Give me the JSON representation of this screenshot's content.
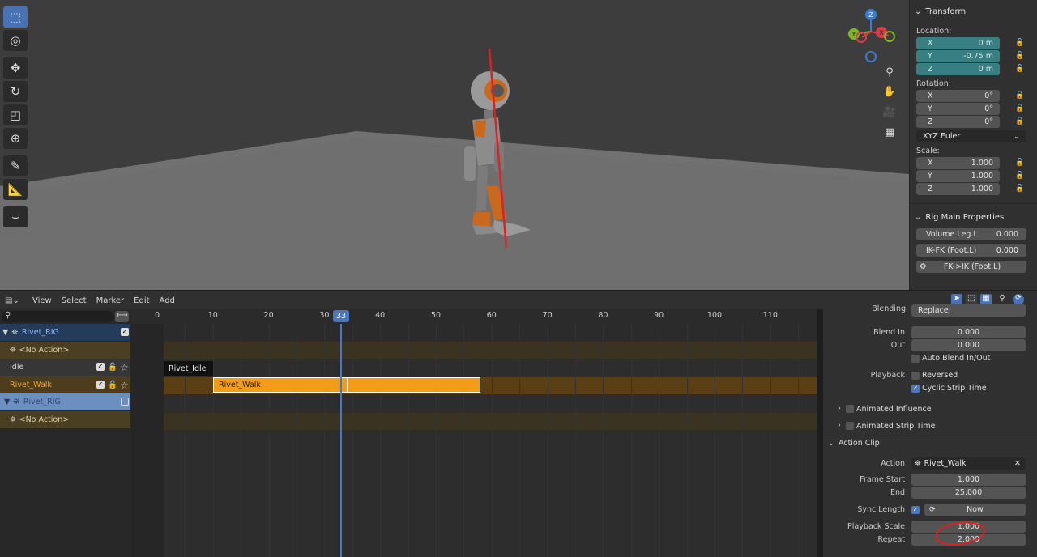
{
  "transform": {
    "title": "Transform",
    "location_label": "Location:",
    "location": [
      {
        "axis": "X",
        "value": "0 m"
      },
      {
        "axis": "Y",
        "value": "-0.75 m"
      },
      {
        "axis": "Z",
        "value": "0 m"
      }
    ],
    "rotation_label": "Rotation:",
    "rotation": [
      {
        "axis": "X",
        "value": "0°"
      },
      {
        "axis": "Y",
        "value": "0°"
      },
      {
        "axis": "Z",
        "value": "0°"
      }
    ],
    "rotation_mode": "XYZ Euler",
    "scale_label": "Scale:",
    "scale": [
      {
        "axis": "X",
        "value": "1.000"
      },
      {
        "axis": "Y",
        "value": "1.000"
      },
      {
        "axis": "Z",
        "value": "1.000"
      }
    ]
  },
  "rig": {
    "title": "Rig Main Properties",
    "props": [
      {
        "label": "Volume Leg.L",
        "value": "0.000"
      },
      {
        "label": "IK-FK (Foot.L)",
        "value": "0.000"
      }
    ],
    "button": "FK->IK (Foot.L)"
  },
  "gizmo": {
    "z": "Z",
    "y": "Y",
    "x": "X"
  },
  "menu": [
    "View",
    "Select",
    "Marker",
    "Edit",
    "Add"
  ],
  "ruler": {
    "ticks": [
      "0",
      "10",
      "20",
      "30",
      "40",
      "50",
      "60",
      "70",
      "80",
      "90",
      "100",
      "110"
    ],
    "current": "33"
  },
  "channels": [
    {
      "name": "Rivet_RIG"
    },
    {
      "name": "<No Action>"
    },
    {
      "name": "Idle"
    },
    {
      "name": "Rivet_Walk"
    },
    {
      "name": "Rivet_RIG"
    },
    {
      "name": "<No Action>"
    }
  ],
  "strips": {
    "idle": "Rivet_Idle",
    "walk": "Rivet_Walk"
  },
  "props": {
    "blending_label": "Blending",
    "blending_value": "Replace",
    "blend_in_label": "Blend In",
    "blend_in": "0.000",
    "out_label": "Out",
    "out": "0.000",
    "auto_blend": "Auto Blend In/Out",
    "playback_label": "Playback",
    "reversed": "Reversed",
    "cyclic": "Cyclic Strip Time",
    "animated_influence": "Animated Influence",
    "animated_strip_time": "Animated Strip Time",
    "action_clip": "Action Clip",
    "action_label": "Action",
    "action_value": "Rivet_Walk",
    "frame_start_label": "Frame Start",
    "frame_start": "1.000",
    "end_label": "End",
    "end": "25.000",
    "sync_label": "Sync Length",
    "sync_now": "Now",
    "scale_label": "Playback Scale",
    "scale": "1.000",
    "repeat_label": "Repeat",
    "repeat": "2.000"
  }
}
